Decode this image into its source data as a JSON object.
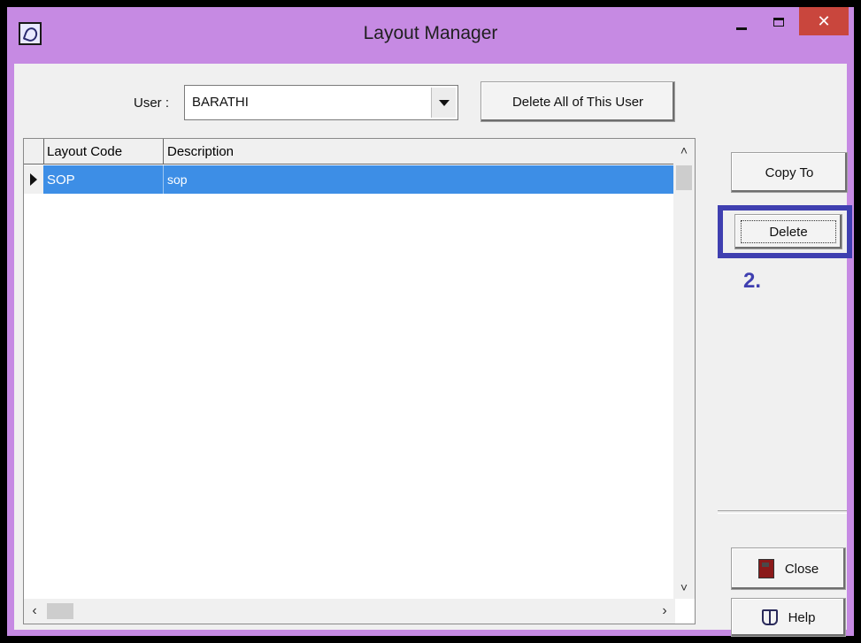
{
  "window": {
    "title": "Layout Manager",
    "title_bar_color": "#c68ae3",
    "close_button_color": "#c9463d"
  },
  "user_row": {
    "label": "User :",
    "selected_user": "BARATHI",
    "delete_all_label": "Delete All of This User"
  },
  "grid": {
    "columns": [
      "Layout Code",
      "Description"
    ],
    "rows": [
      {
        "code": "SOP",
        "description": "sop",
        "selected": true
      }
    ],
    "selection_color": "#3d8ee6"
  },
  "side_buttons": {
    "copy_to": "Copy To",
    "delete": "Delete",
    "close": "Close",
    "help": "Help"
  },
  "annotation": {
    "step": "2.",
    "color": "#3f3fb0"
  },
  "icons": [
    "app-icon",
    "minimize-icon",
    "maximize-icon",
    "close-icon",
    "dropdown-arrow-icon",
    "row-pointer-icon",
    "door-icon",
    "book-icon"
  ]
}
